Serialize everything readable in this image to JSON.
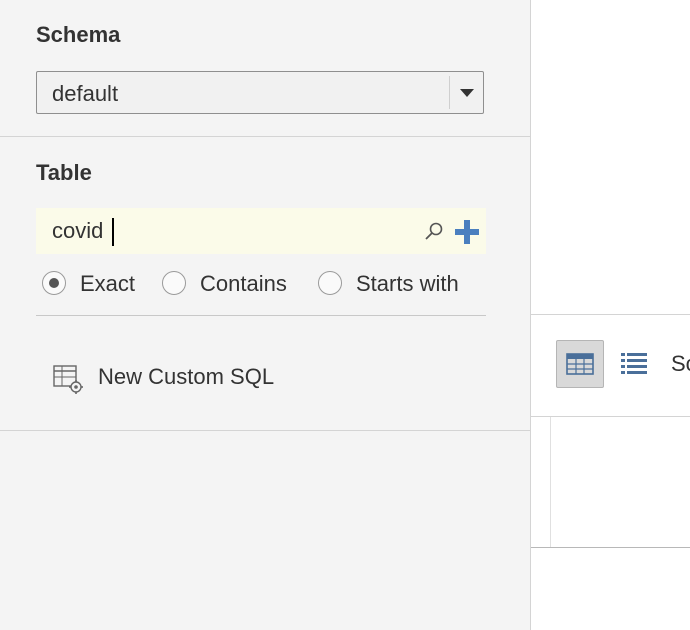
{
  "schema": {
    "title": "Schema",
    "selected_value": "default"
  },
  "table": {
    "title": "Table",
    "search_value": "covid",
    "search_icon": "search-icon",
    "add_icon": "plus-icon",
    "match_options": [
      {
        "label": "Exact",
        "selected": true
      },
      {
        "label": "Contains",
        "selected": false
      },
      {
        "label": "Starts with",
        "selected": false
      }
    ]
  },
  "custom_sql": {
    "label": "New Custom SQL",
    "icon": "custom-sql-icon"
  },
  "right_toolbar": {
    "grid_view_icon": "grid-view-icon",
    "list_view_icon": "list-view-icon",
    "truncated_text": "Sc"
  },
  "colors": {
    "panel_bg": "#f4f4f4",
    "search_bg": "#fbfbe9",
    "add_icon": "#4a7fbf",
    "grid_active_bg": "#d9d9d9"
  }
}
